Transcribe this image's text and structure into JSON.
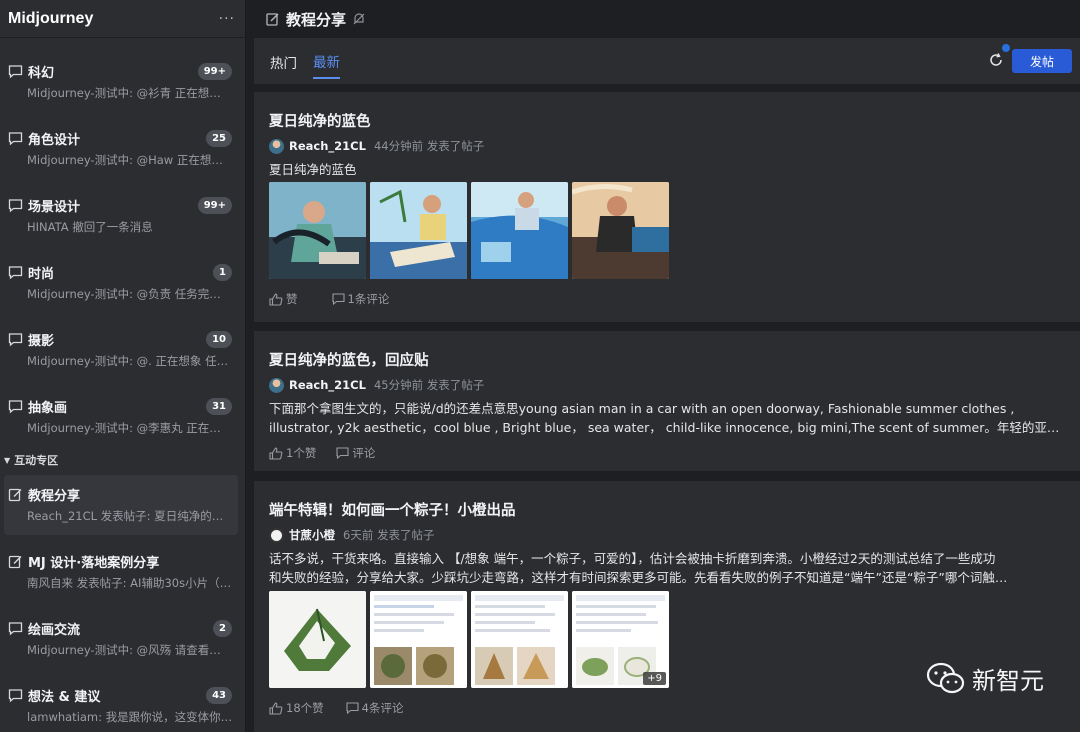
{
  "app": {
    "title": "Midjourney",
    "more": "···"
  },
  "sidebar": {
    "channels": [
      {
        "name": "科幻",
        "badge": "99+",
        "preview": "Midjourney-测试中: @衫青 正在想…"
      },
      {
        "name": "角色设计",
        "badge": "25",
        "preview": "Midjourney-测试中: @Haw 正在想…"
      },
      {
        "name": "场景设计",
        "badge": "99+",
        "preview": "HINATA 撤回了一条消息"
      },
      {
        "name": "时尚",
        "badge": "1",
        "preview": "Midjourney-测试中: @负责 任务完…"
      },
      {
        "name": "摄影",
        "badge": "10",
        "preview": "Midjourney-测试中: @. 正在想象 任…"
      },
      {
        "name": "抽象画",
        "badge": "31",
        "preview": "Midjourney-测试中: @李惠丸 正在…"
      }
    ],
    "section_label": "互动专区",
    "forums": [
      {
        "name": "教程分享",
        "badge": "",
        "preview": "Reach_21CL 发表帖子: 夏日纯净的…"
      },
      {
        "name": "MJ 设计·落地案例分享",
        "badge": "",
        "preview": "南风自来 发表帖子: AI辅助30s小片（…"
      },
      {
        "name": "绘画交流",
        "badge": "2",
        "preview": "Midjourney-测试中: @风殇 请查看…"
      },
      {
        "name": "想法 & 建议",
        "badge": "43",
        "preview": "lamwhatiam: 我是跟你说，这变体你…"
      }
    ]
  },
  "main": {
    "channel_title": "教程分享",
    "tabs": [
      {
        "label": "热门"
      },
      {
        "label": "最新"
      }
    ],
    "post_button": "发帖",
    "posts": [
      {
        "title": "夏日纯净的蓝色",
        "author": "Reach_21CL",
        "time": "44分钟前 发表了帖子",
        "body": "夏日纯净的蓝色",
        "likes": "赞",
        "comments": "1条评论"
      },
      {
        "title": "夏日纯净的蓝色，回应贴",
        "author": "Reach_21CL",
        "time": "45分钟前 发表了帖子",
        "body_line1": "下面那个拿图生文的，只能说/d的还差点意思young asian man in a car with an open doorway, Fashionable summer clothes ,",
        "body_line2": "illustrator, y2k aesthetic，cool blue , Bright blue， sea water， child-like innocence, big mini,The scent of summer。年轻的亚…",
        "likes": "1个赞",
        "comments": "评论"
      },
      {
        "title": "端午特辑！如何画一个粽子！小橙出品",
        "author": "甘蔗小橙",
        "time": "6天前 发表了帖子",
        "body_line1": "话不多说，干货来咯。直接输入 【/想象 端午，一个粽子，可爱的】，估计会被抽卡折磨到奔溃。小橙经过2天的测试总结了一些成功",
        "body_line2": "和失败的经验，分享给大家。少踩坑少走弯路，这样才有时间探索更多可能。先看看失败的例子不知道是“端午”还是“粽子”哪个词触…",
        "more_images": "+9",
        "likes": "18个赞",
        "comments": "4条评论"
      }
    ]
  },
  "watermark": {
    "text": "新智元"
  }
}
